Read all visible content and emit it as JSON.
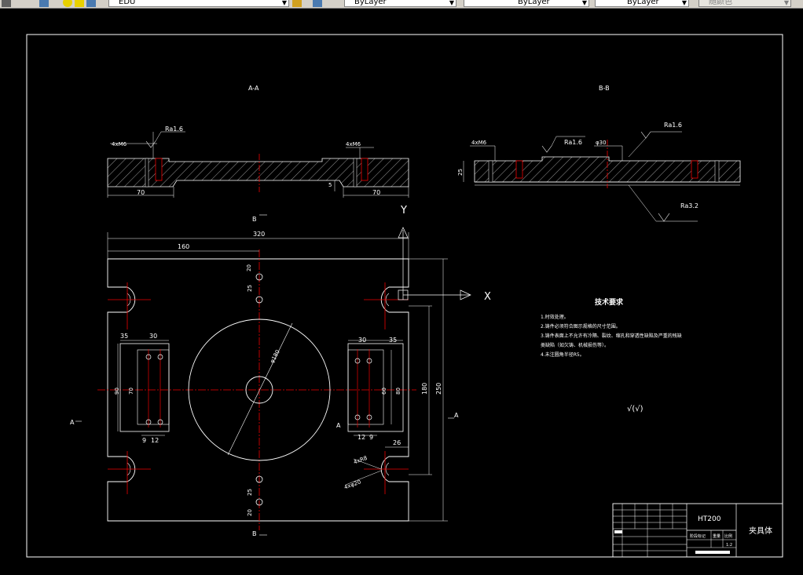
{
  "toolbar": {
    "layer_name": "EDU",
    "color_label": "ByLayer",
    "linetype_label": "ByLayer",
    "lineweight_label": "ByLayer",
    "plotstyle_label": "随颜色"
  },
  "drawing": {
    "section_aa_label": "A-A",
    "section_bb_label": "B-B",
    "aa_view": {
      "hole_note": "4xM6",
      "roughness_left": "Ra1.6",
      "hole_note_right": "4xM6",
      "dim_left_70": "70",
      "dim_right_70": "70",
      "dim_depth": "5"
    },
    "bb_view": {
      "dim_thickness": "25",
      "hole_note": "4xM6",
      "roughness_mid": "Ra1.6",
      "dia_note": "φ30",
      "roughness_top": "Ra1.6",
      "roughness_bottom": "Ra3.2"
    },
    "plan_view": {
      "dim_total_width": "320",
      "dim_half_width": "160",
      "dim_20_top": "20",
      "dim_25_top": "25",
      "dim_35_left": "35",
      "dim_30_left": "30",
      "dim_30_right": "30",
      "dim_35_right": "35",
      "dim_90_left": "90",
      "dim_70_left": "70",
      "dim_60_right": "60",
      "dim_80_right": "80",
      "dim_180": "180",
      "dim_250": "250",
      "dim_9_left": "9",
      "dim_12_left": "12",
      "dim_12_right": "12",
      "dim_9_right": "9",
      "dim_25_bottom": "25",
      "dim_20_bottom": "20",
      "dim_26": "26",
      "note_r": "4xR8",
      "note_phi": "4xφ20",
      "dia_large": "φ180",
      "label_b_top": "B",
      "label_b_bottom": "B",
      "label_a_left": "A",
      "label_a_right": "A",
      "label_a_inner": "A",
      "axis_y": "Y",
      "axis_x": "X"
    },
    "tech_requirements": {
      "title": "技术要求",
      "items": [
        "1.时效处理。",
        "2.铸件必须符合图示规格的尺寸范围。",
        "3.铸件表面上不允许有冷隔、裂纹、缩孔和穿透性缺陷及严重的残缺",
        "类缺陷（如欠铸、机械损伤等）。",
        "4.未注圆角半径R5。"
      ],
      "roughness_symbol": "√(√)"
    },
    "title_block": {
      "material": "HT200",
      "part_name": "夹具体",
      "scale_label": "比例",
      "weight_label": "重量",
      "stage_label": "阶段标记",
      "sheet": "1:2"
    }
  }
}
